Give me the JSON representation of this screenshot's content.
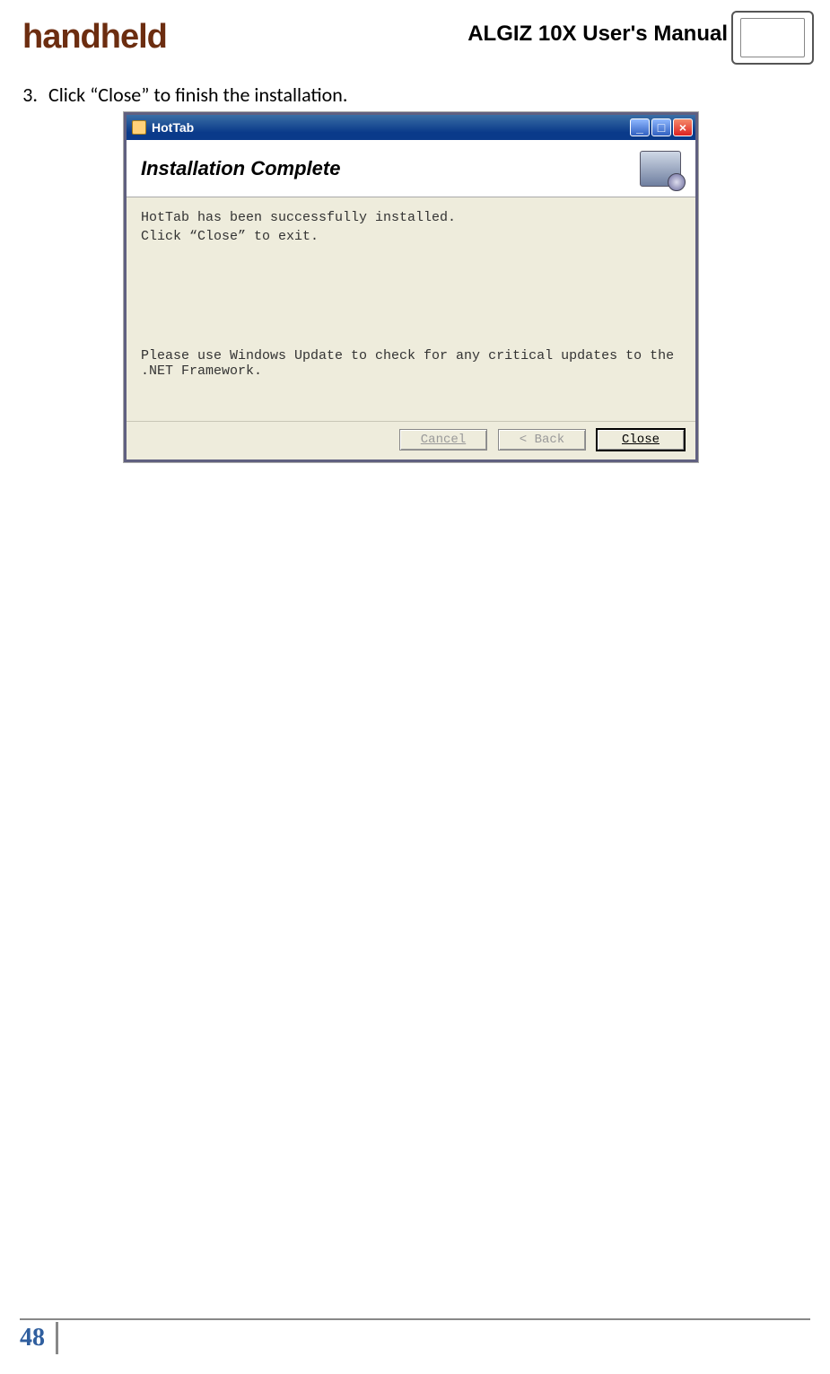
{
  "header": {
    "brand": "handheld",
    "manual_title": "ALGIZ 10X User's Manual"
  },
  "step": {
    "number": "3.",
    "text": "Click “Close” to finish the installation."
  },
  "installer": {
    "window_title": "HotTab",
    "banner_title": "Installation Complete",
    "body_line1": "HotTab has been successfully installed.",
    "body_line2": "Click “Close” to exit.",
    "body_note": "Please use Windows Update to check for any critical updates to the .NET Framework.",
    "buttons": {
      "cancel": "Cancel",
      "back": "< Back",
      "close": "Close"
    }
  },
  "footer": {
    "page_number": "48"
  }
}
